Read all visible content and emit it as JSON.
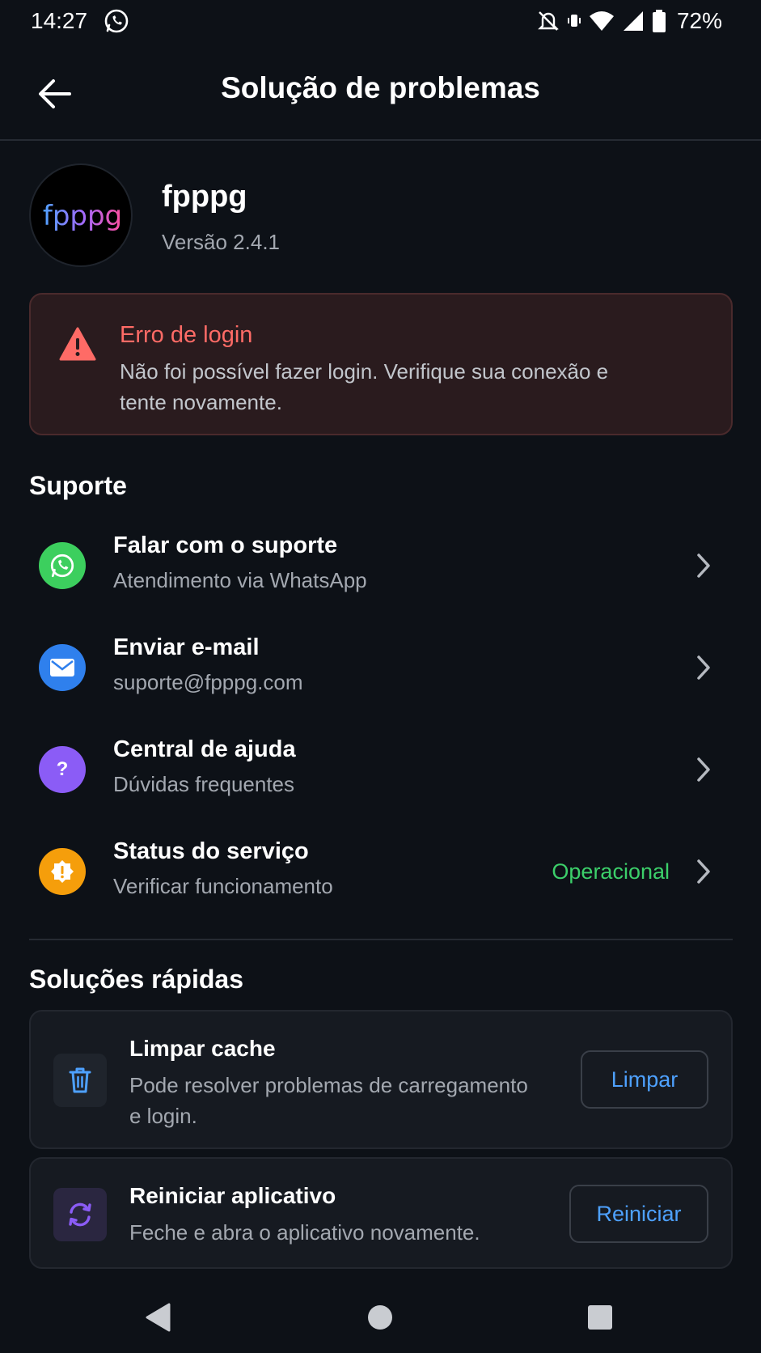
{
  "status_bar": {
    "time": "14:27",
    "battery_percent": "72%",
    "icons": [
      "whatsapp-icon",
      "alarm-off-icon",
      "vibrate-icon",
      "wifi-icon",
      "signal-icon",
      "battery-icon"
    ]
  },
  "header": {
    "title": "Solução de problemas",
    "back_icon": "arrow-left-icon"
  },
  "app": {
    "logo_text": "fpppg",
    "name": "fpppg",
    "version": "Versão 2.4.1"
  },
  "error": {
    "title": "Erro de login",
    "message": "Não foi possível fazer login. Verifique sua conexão e tente novamente.",
    "icon": "warning-icon",
    "color": "#ff6b66"
  },
  "support": {
    "title": "Suporte",
    "items": [
      {
        "label": "Falar com o suporte",
        "sublabel": "Atendimento via WhatsApp",
        "icon": "whatsapp-icon",
        "color": "#3ccf5e"
      },
      {
        "label": "Enviar e-mail",
        "sublabel": "suporte@fpppg.com",
        "icon": "mail-icon",
        "color": "#2f80ed"
      },
      {
        "label": "Central de ajuda",
        "sublabel": "Dúvidas frequentes",
        "icon": "help-icon",
        "color": "#8b5cf6"
      },
      {
        "label": "Status do serviço",
        "sublabel": "Verificar funcionamento",
        "icon": "status-alert-icon",
        "color": "#f59e0b",
        "status": "Operacional",
        "status_color": "#3ccf6a"
      }
    ]
  },
  "quick_solutions": {
    "title": "Soluções rápidas",
    "items": [
      {
        "title": "Limpar cache",
        "description": "Pode resolver problemas de carregamento e login.",
        "button": "Limpar",
        "icon": "trash-icon"
      },
      {
        "title": "Reiniciar aplicativo",
        "description": "Feche e abra o aplicativo novamente.",
        "button": "Reiniciar",
        "icon": "refresh-icon"
      }
    ]
  },
  "nav_bar": {
    "buttons": [
      "back-triangle-icon",
      "home-circle-icon",
      "recents-square-icon"
    ]
  }
}
